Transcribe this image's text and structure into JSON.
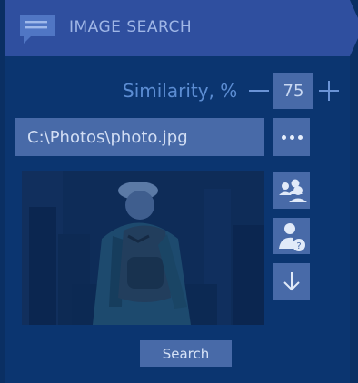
{
  "header": {
    "title": "IMAGE SEARCH",
    "icon": "message-lines-icon"
  },
  "similarity": {
    "label": "Similarity, %",
    "value": "75"
  },
  "path": {
    "value": "C:\\Photos\\photo.jpg"
  },
  "buttons": {
    "browse_icon": "more-dots-icon",
    "group_icon": "group-users-icon",
    "user_unknown_icon": "user-question-icon",
    "download_icon": "arrow-down-icon",
    "search_label": "Search"
  },
  "colors": {
    "background": "#0b3570",
    "header": "#2f4f9f",
    "control": "#486aa8",
    "label": "#5c8dd3"
  }
}
